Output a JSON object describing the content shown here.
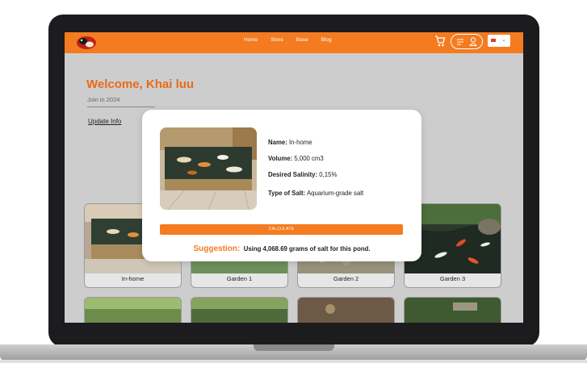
{
  "nav": {
    "links": [
      "Home",
      "Store",
      "Base",
      "Blog"
    ],
    "icons": [
      "koi-logo",
      "cart-icon",
      "menu-icon",
      "user-icon",
      "flag-icon",
      "chevron-down-icon"
    ],
    "accent": "#f47b20"
  },
  "profile": {
    "welcome": "Welcome, Khai luu",
    "join": "Join in 2024",
    "update_label": "Update Info"
  },
  "ponds": [
    {
      "label": "In-home"
    },
    {
      "label": "Garden 1"
    },
    {
      "label": "Garden 2"
    },
    {
      "label": "Garden 3"
    }
  ],
  "modal": {
    "name_key": "Name:",
    "name_val": "In-home",
    "volume_key": "Volume:",
    "volume_val": "5,000 cm3",
    "salinity_key": "Desired Salinity:",
    "salinity_val": "0,15%",
    "salt_key": "Type of Salt:",
    "salt_val": "Aquarium-grade salt",
    "calc_label": "CALCULATE",
    "suggestion_label": "Suggestion:",
    "suggestion_text": "Using 4,068.69 grams of salt for this pond."
  }
}
